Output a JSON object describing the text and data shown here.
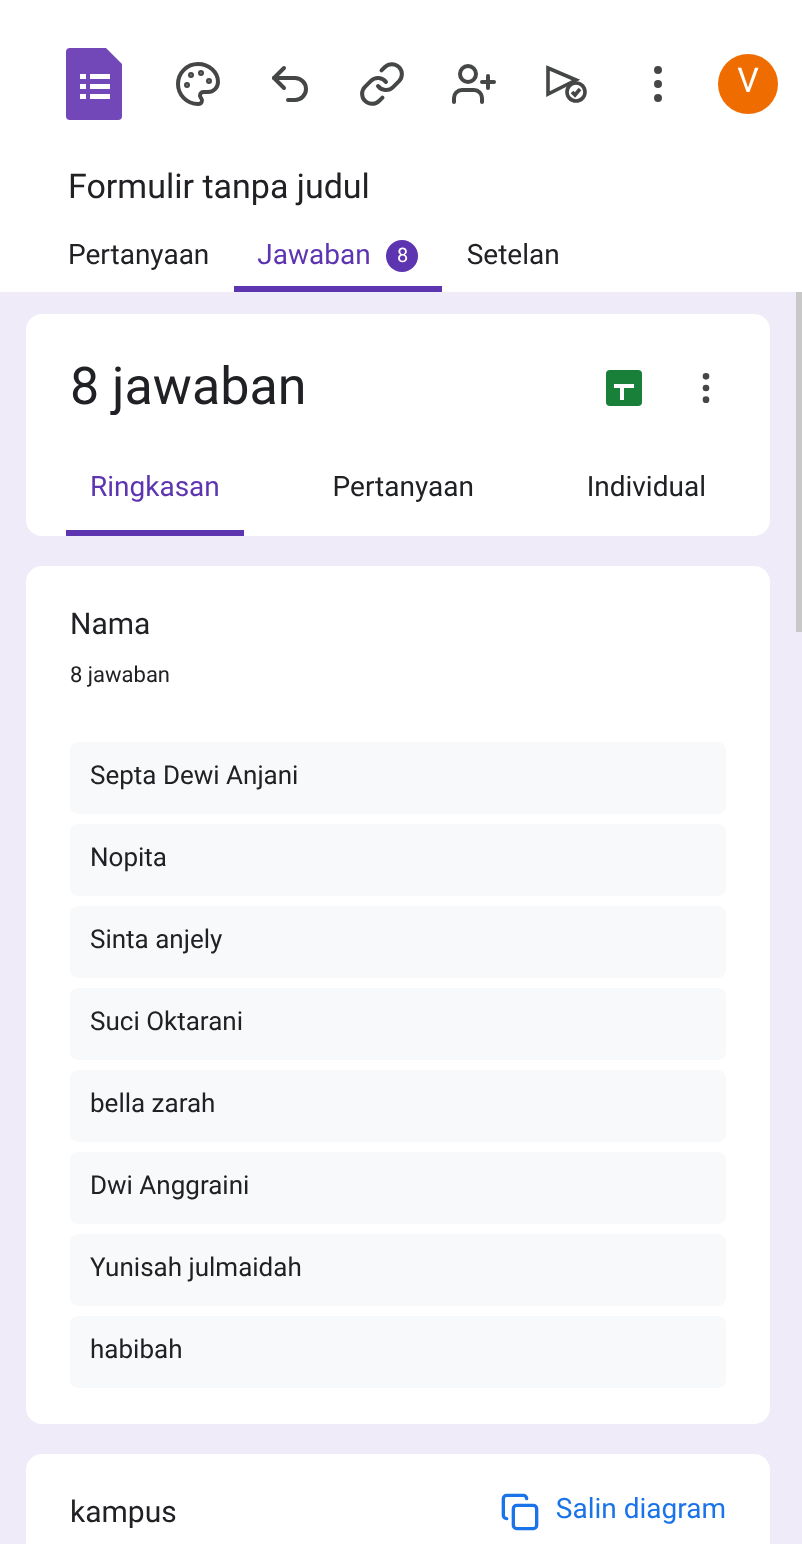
{
  "app_bar": {
    "avatar": "V"
  },
  "form_title": "Formulir tanpa judul",
  "tabs": [
    {
      "label": "Pertanyaan",
      "selected": false
    },
    {
      "label": "Jawaban",
      "selected": true,
      "badge": "8"
    },
    {
      "label": "Setelan",
      "selected": false
    }
  ],
  "summary_card": {
    "title": "8 jawaban",
    "tabs": [
      {
        "label": "Ringkasan",
        "selected": true
      },
      {
        "label": "Pertanyaan",
        "selected": false
      },
      {
        "label": "Individual",
        "selected": false
      }
    ]
  },
  "questions": [
    {
      "title": "Nama",
      "count": "8 jawaban",
      "answers": [
        "Septa Dewi Anjani",
        "Nopita",
        "Sinta anjely",
        "Suci Oktarani",
        "bella zarah",
        "Dwi Anggraini",
        "Yunisah julmaidah",
        "habibah"
      ]
    },
    {
      "title": "kampus",
      "action": "Salin diagram"
    }
  ]
}
